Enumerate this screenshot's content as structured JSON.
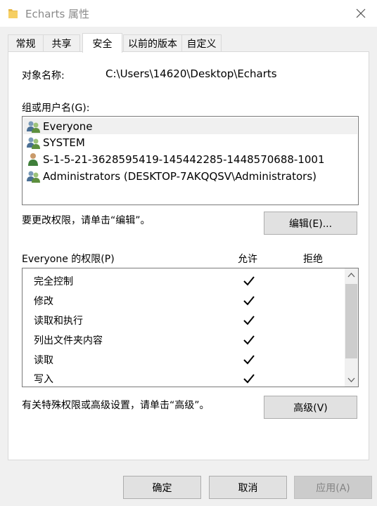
{
  "window": {
    "title": "Echarts 属性",
    "folder_color": "#e8b84a"
  },
  "tabs": [
    {
      "label": "常规"
    },
    {
      "label": "共享"
    },
    {
      "label": "安全",
      "active": true
    },
    {
      "label": "以前的版本"
    },
    {
      "label": "自定义"
    }
  ],
  "security": {
    "object_name_label": "对象名称:",
    "object_name_value": "C:\\Users\\14620\\Desktop\\Echarts",
    "groups_label": "组或用户名(G):",
    "groups": [
      {
        "name": "Everyone",
        "icon": "group-icon",
        "selected": true
      },
      {
        "name": "SYSTEM",
        "icon": "group-icon"
      },
      {
        "name": "S-1-5-21-3628595419-145442285-1448570688-1001",
        "icon": "user-icon"
      },
      {
        "name": "Administrators (DESKTOP-7AKQQSV\\Administrators)",
        "icon": "group-icon"
      }
    ],
    "edit_hint": "要更改权限，请单击“编辑”。",
    "edit_button": "编辑(E)...",
    "permissions_label": "Everyone 的权限(P)",
    "allow_header": "允许",
    "deny_header": "拒绝",
    "permissions": [
      {
        "name": "完全控制",
        "allow": true,
        "deny": false
      },
      {
        "name": "修改",
        "allow": true,
        "deny": false
      },
      {
        "name": "读取和执行",
        "allow": true,
        "deny": false
      },
      {
        "name": "列出文件夹内容",
        "allow": true,
        "deny": false
      },
      {
        "name": "读取",
        "allow": true,
        "deny": false
      },
      {
        "name": "写入",
        "allow": true,
        "deny": false
      }
    ],
    "advanced_hint": "有关特殊权限或高级设置，请单击“高级”。",
    "advanced_button": "高级(V)"
  },
  "footer": {
    "ok_label": "确定",
    "cancel_label": "取消",
    "apply_label": "应用(A)"
  }
}
